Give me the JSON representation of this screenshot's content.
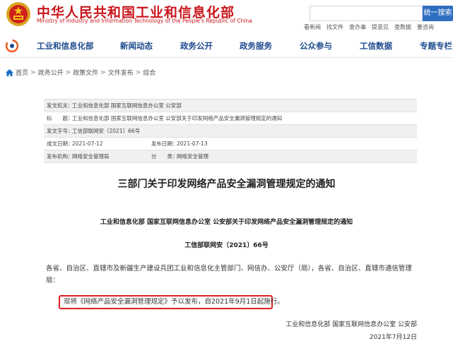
{
  "header": {
    "site_title": "中华人民共和国工业和信息化部",
    "site_subtitle": "Ministry of Industry and Information Technology of the People's Republic of China",
    "search_button": "统一搜索",
    "quick_links": [
      "看新闻",
      "找文件",
      "查办事",
      "提意见",
      "查数据",
      "要咨询"
    ]
  },
  "nav": {
    "items": [
      "工业和信息化部",
      "新闻动态",
      "政务公开",
      "政务服务",
      "公众参与",
      "工信数据",
      "专题专栏"
    ]
  },
  "breadcrumb": [
    "首页",
    "政务公开",
    "政策文件",
    "文件发布",
    "综合"
  ],
  "meta": {
    "issuer_label": "发文机关：",
    "issuer": "工业和信息化部 国家互联网信息办公室 公安部",
    "title_label": "标　　题：",
    "title": "工业和信息化部 国家互联网信息办公室 公安部关于印发网络产品安全漏洞管理规定的通知",
    "docno_label": "发文字号：",
    "docno": "工信部联网安〔2021〕66号",
    "created_label": "成文日期：",
    "created": "2021-07-12",
    "published_label": "发布日期：",
    "published": "2021-07-13",
    "org_label": "发布机构：",
    "org": "网络安全管理局",
    "category_label": "分　　类：",
    "category": "网络安全管理"
  },
  "article": {
    "title": "三部门关于印发网络产品安全漏洞管理规定的通知",
    "subhead": "工业和信息化部 国家互联网信息办公室 公安部关于印发网络产品安全漏洞管理规定的通知",
    "docno": "工信部联网安〔2021〕66号",
    "addressees": "各省、自治区、直辖市及新疆生产建设兵团工业和信息化主管部门、网信办、公安厅（局），各省、自治区、直辖市通信管理局：",
    "notice": "现将《网络产品安全漏洞管理规定》予以发布，自2021年9月1日起施行。",
    "signature": "工业和信息化部 国家互联网信息办公室 公安部",
    "date": "2021年7月12日"
  },
  "colors": {
    "brand_red": "#c8161d",
    "nav_blue": "#1d4b8f",
    "search_blue": "#2f6fc1",
    "highlight_red": "#e02020"
  }
}
